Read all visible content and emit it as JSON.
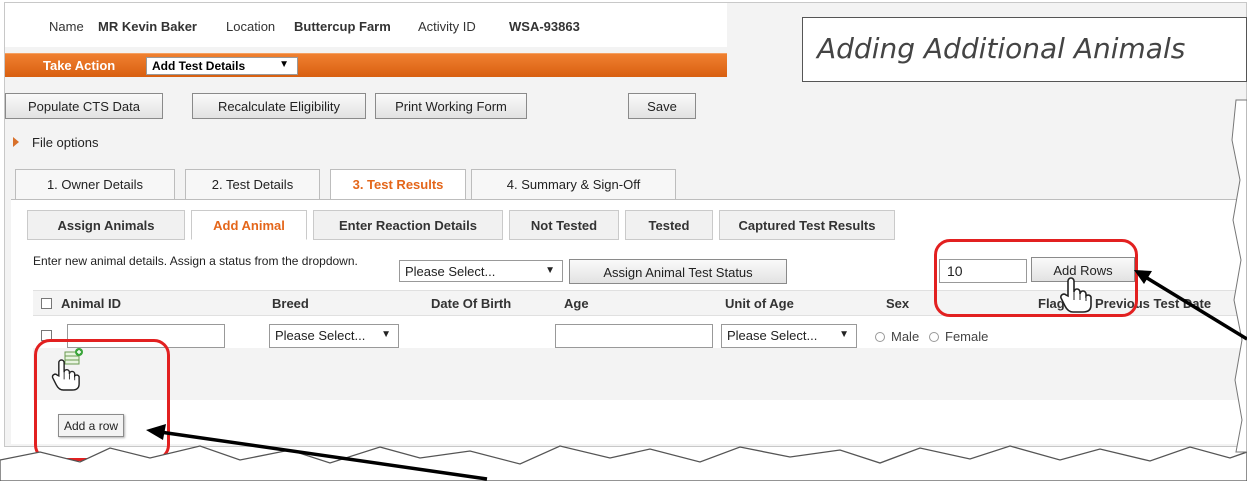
{
  "header": {
    "name_label": "Name",
    "name_value": "MR Kevin Baker",
    "location_label": "Location",
    "location_value": "Buttercup Farm",
    "activity_label": "Activity ID",
    "activity_value": "WSA-93863"
  },
  "action_bar": {
    "take_action": "Take Action",
    "selected_action": "Add Test Details"
  },
  "toolbar": {
    "populate": "Populate CTS Data",
    "recalculate": "Recalculate Eligibility",
    "print": "Print Working Form",
    "save": "Save"
  },
  "callout_title": "Adding Additional Animals",
  "file_options": "File options",
  "main_tabs": [
    "1. Owner Details",
    "2. Test Details",
    "3. Test Results",
    "4. Summary & Sign-Off"
  ],
  "sub_tabs": [
    "Assign Animals",
    "Add Animal",
    "Enter Reaction Details",
    "Not Tested",
    "Tested",
    "Captured Test Results"
  ],
  "instructions": "Enter new animal details. Assign a status from the dropdown.",
  "status_select": "Please Select...",
  "assign_button": "Assign Animal Test Status",
  "rows_count": "10",
  "add_rows_button": "Add Rows",
  "columns": [
    "Animal ID",
    "Breed",
    "Date Of Birth",
    "Age",
    "Unit of Age",
    "Sex",
    "Flag",
    "Previous Test Date"
  ],
  "row": {
    "breed_select": "Please Select...",
    "unit_select": "Please Select...",
    "sex_male": "Male",
    "sex_female": "Female"
  },
  "tooltip": "Add a row",
  "colors": {
    "accent_orange": "#e4661a",
    "bar_orange": "#e06a1c",
    "highlight_red": "#e22020"
  },
  "icons": [
    "add-row-icon",
    "hand-cursor-icon",
    "dropdown-chevron-icon",
    "arrow-icon"
  ]
}
